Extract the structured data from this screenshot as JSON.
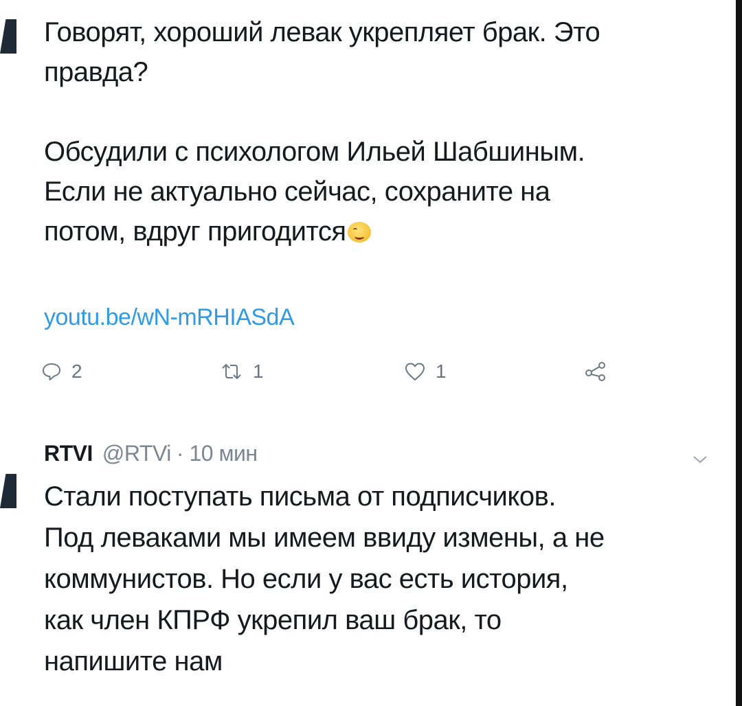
{
  "tweet1": {
    "lines_para1": [
      "Говорят, хороший левак укрепляет брак. Это",
      "правда?"
    ],
    "lines_para2": [
      "Обсудили с психологом Ильей Шабшиным.",
      "Если не актуально сейчас, сохраните на",
      "потом, вдруг пригодится"
    ],
    "emoji": "winking-face",
    "link": "youtu.be/wN-mRHIASdA",
    "actions": {
      "reply_count": "2",
      "retweet_count": "1",
      "like_count": "1"
    }
  },
  "tweet2": {
    "author_name": "RTVI",
    "author_handle": "@RTVi",
    "separator": "·",
    "time": "10 мин",
    "lines": [
      "Стали поступать письма от подписчиков.",
      "Под леваками мы имеем ввиду измены, а не",
      "коммунистов. Но если у вас есть история,",
      "как член КПРФ укрепил ваш брак, то",
      "напишите нам"
    ]
  },
  "icons": {
    "reply": "reply-icon",
    "retweet": "retweet-icon",
    "like": "heart-icon",
    "share": "share-icon",
    "menu": "chevron-down-icon"
  },
  "colors": {
    "text": "#16191d",
    "secondary": "#657786",
    "link": "#2f9be6"
  }
}
